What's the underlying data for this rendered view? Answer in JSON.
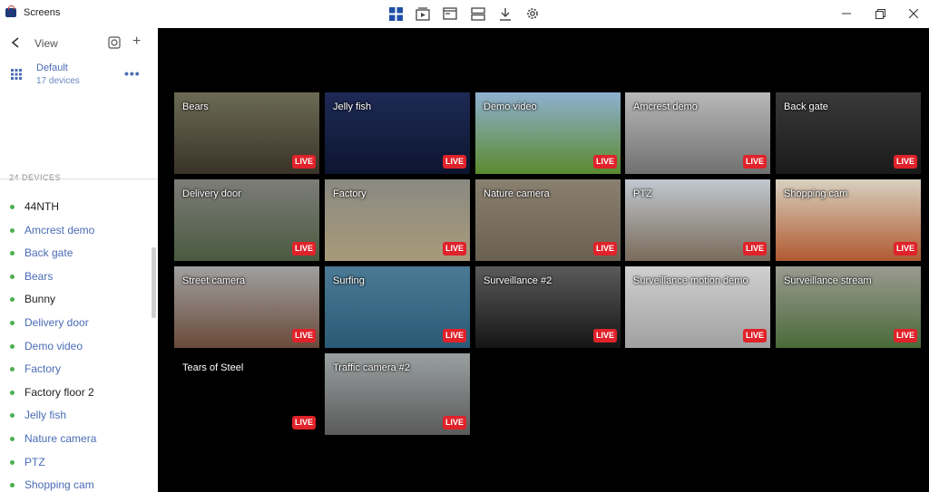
{
  "app": {
    "title": "Screens"
  },
  "sidebar": {
    "view_label": "View",
    "default_title": "Default",
    "default_sub": "17 devices",
    "devices_count": "24 DEVICES",
    "devices": [
      {
        "name": "44NTH",
        "dark": true
      },
      {
        "name": "Amcrest demo",
        "dark": false
      },
      {
        "name": "Back gate",
        "dark": false
      },
      {
        "name": "Bears",
        "dark": false
      },
      {
        "name": "Bunny",
        "dark": true
      },
      {
        "name": "Delivery door",
        "dark": false
      },
      {
        "name": "Demo video",
        "dark": false
      },
      {
        "name": "Factory",
        "dark": false
      },
      {
        "name": "Factory floor 2",
        "dark": true
      },
      {
        "name": "Jelly fish",
        "dark": false
      },
      {
        "name": "Nature camera",
        "dark": false
      },
      {
        "name": "PTZ",
        "dark": false
      },
      {
        "name": "Shopping cam",
        "dark": false
      }
    ]
  },
  "live_label": "LIVE",
  "cameras": [
    {
      "name": "Bears",
      "top": "#6b6b55",
      "bottom": "#3a3328"
    },
    {
      "name": "Jelly fish",
      "top": "#1e2a55",
      "bottom": "#0c1530"
    },
    {
      "name": "Demo video",
      "top": "#8fb0d0",
      "bottom": "#5a8a2e"
    },
    {
      "name": "Amcrest demo",
      "top": "#b8b8b8",
      "bottom": "#707070"
    },
    {
      "name": "Back gate",
      "top": "#3a3a3a",
      "bottom": "#1a1a1a"
    },
    {
      "name": "Delivery door",
      "top": "#7d7d78",
      "bottom": "#4a5a40"
    },
    {
      "name": "Factory",
      "top": "#8a8a82",
      "bottom": "#a89a7a"
    },
    {
      "name": "Nature camera",
      "top": "#8a8070",
      "bottom": "#6a6050"
    },
    {
      "name": "PTZ",
      "top": "#c0c8d0",
      "bottom": "#7a6a5a"
    },
    {
      "name": "Shopping cam",
      "top": "#d8d0c0",
      "bottom": "#b05a30"
    },
    {
      "name": "Street camera",
      "top": "#a0a0a0",
      "bottom": "#6a4a3a"
    },
    {
      "name": "Surfing",
      "top": "#4a7a95",
      "bottom": "#2a5a75"
    },
    {
      "name": "Surveillance #2",
      "top": "#5a5a5a",
      "bottom": "#151515"
    },
    {
      "name": "Surveillance motion demo",
      "top": "#d0d0d0",
      "bottom": "#a0a0a0"
    },
    {
      "name": "Surveillance stream",
      "top": "#9a9a90",
      "bottom": "#4a6a3a"
    },
    {
      "name": "Tears of Steel",
      "top": "#000000",
      "bottom": "#000000"
    },
    {
      "name": "Traffic camera #2",
      "top": "#9aa0a0",
      "bottom": "#5a5a5a"
    }
  ]
}
